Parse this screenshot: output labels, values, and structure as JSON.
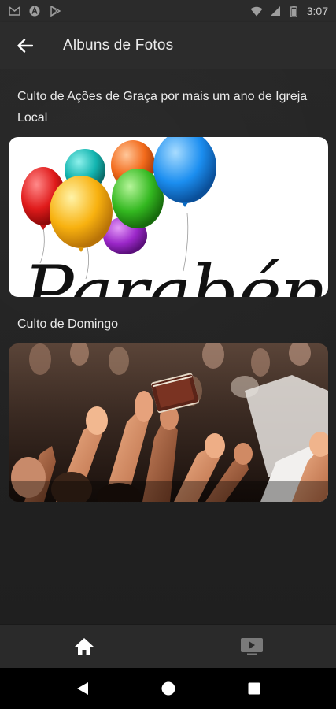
{
  "status_bar": {
    "time": "3:07",
    "left_icons": [
      "gmail-icon",
      "a-icon",
      "play-store-icon"
    ],
    "right_icons": [
      "wifi-icon",
      "signal-icon",
      "battery-icon"
    ]
  },
  "app_bar": {
    "title": "Albuns de Fotos",
    "back_icon": "arrow-left-icon"
  },
  "albums": [
    {
      "title": "Culto de Ações de Graça por mais um ano de Igreja Local",
      "image_text": "Parabéns!",
      "image_kind": "balloons"
    },
    {
      "title": "Culto de Domingo",
      "image_kind": "worship-crowd"
    }
  ],
  "bottom_nav": {
    "items": [
      {
        "icon": "home-icon",
        "active": true
      },
      {
        "icon": "video-icon",
        "active": false
      }
    ]
  },
  "system_nav": {
    "buttons": [
      "back-triangle-icon",
      "home-circle-icon",
      "recents-square-icon"
    ]
  },
  "colors": {
    "background": "#232323",
    "app_bar": "#2c2c2c",
    "text": "#eaeaea",
    "icon_active": "#ffffff",
    "icon_inactive": "#8a8a8a"
  }
}
